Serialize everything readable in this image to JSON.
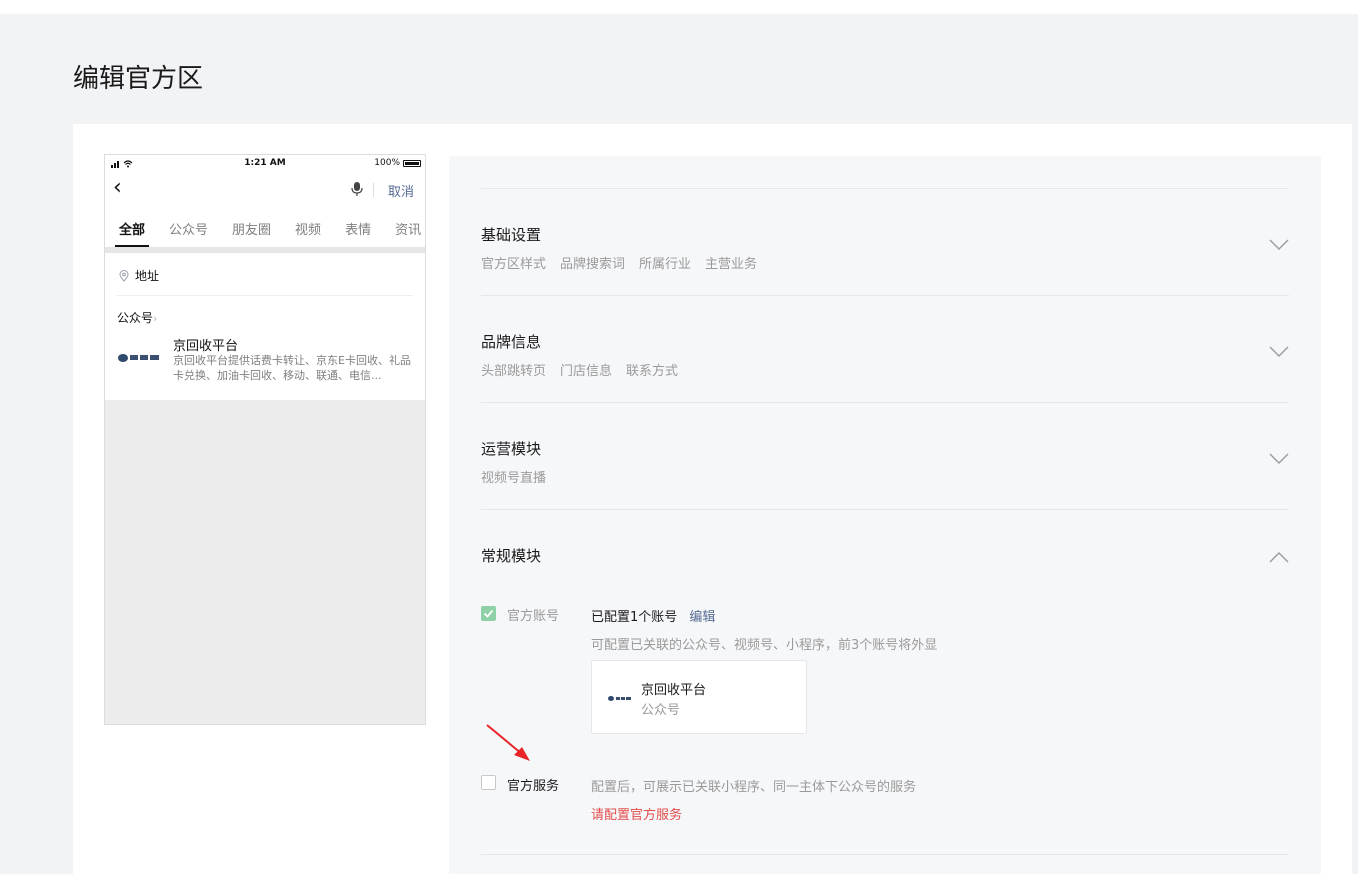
{
  "page": {
    "title": "编辑官方区"
  },
  "phone": {
    "status": {
      "time": "1:21 AM",
      "battery": "100%"
    },
    "cancel_label": "取消",
    "tabs": [
      {
        "label": "全部",
        "active": true
      },
      {
        "label": "公众号",
        "active": false
      },
      {
        "label": "朋友圈",
        "active": false
      },
      {
        "label": "视频",
        "active": false
      },
      {
        "label": "表情",
        "active": false
      },
      {
        "label": "资讯",
        "active": false
      }
    ],
    "address_label": "地址",
    "gzh_section_label": "公众号",
    "account": {
      "name": "京回收平台",
      "description": "京回收平台提供话费卡转让、京东E卡回收、礼品卡兑换、加油卡回收、移动、联通、电信..."
    }
  },
  "sections": [
    {
      "title": "基础设置",
      "subitems": [
        "官方区样式",
        "品牌搜索词",
        "所属行业",
        "主营业务"
      ],
      "expanded": false
    },
    {
      "title": "品牌信息",
      "subitems": [
        "头部跳转页",
        "门店信息",
        "联系方式"
      ],
      "expanded": false
    },
    {
      "title": "运营模块",
      "subitems": [
        "视频号直播"
      ],
      "expanded": false
    },
    {
      "title": "常规模块",
      "subitems": [],
      "expanded": true
    }
  ],
  "regular_module": {
    "official_account": {
      "label": "官方账号",
      "checked": true,
      "status": "已配置1个账号",
      "edit_label": "编辑",
      "hint": "可配置已关联的公众号、视频号、小程序，前3个账号将外显",
      "card": {
        "name": "京回收平台",
        "type": "公众号"
      }
    },
    "official_service": {
      "label": "官方服务",
      "checked": false,
      "hint": "配置后，可展示已关联小程序、同一主体下公众号的服务",
      "warning": "请配置官方服务"
    }
  },
  "colors": {
    "link": "#576b95",
    "warning": "#e34d4d",
    "checked": "#8ed1a7",
    "arrow": "#e8262a"
  }
}
